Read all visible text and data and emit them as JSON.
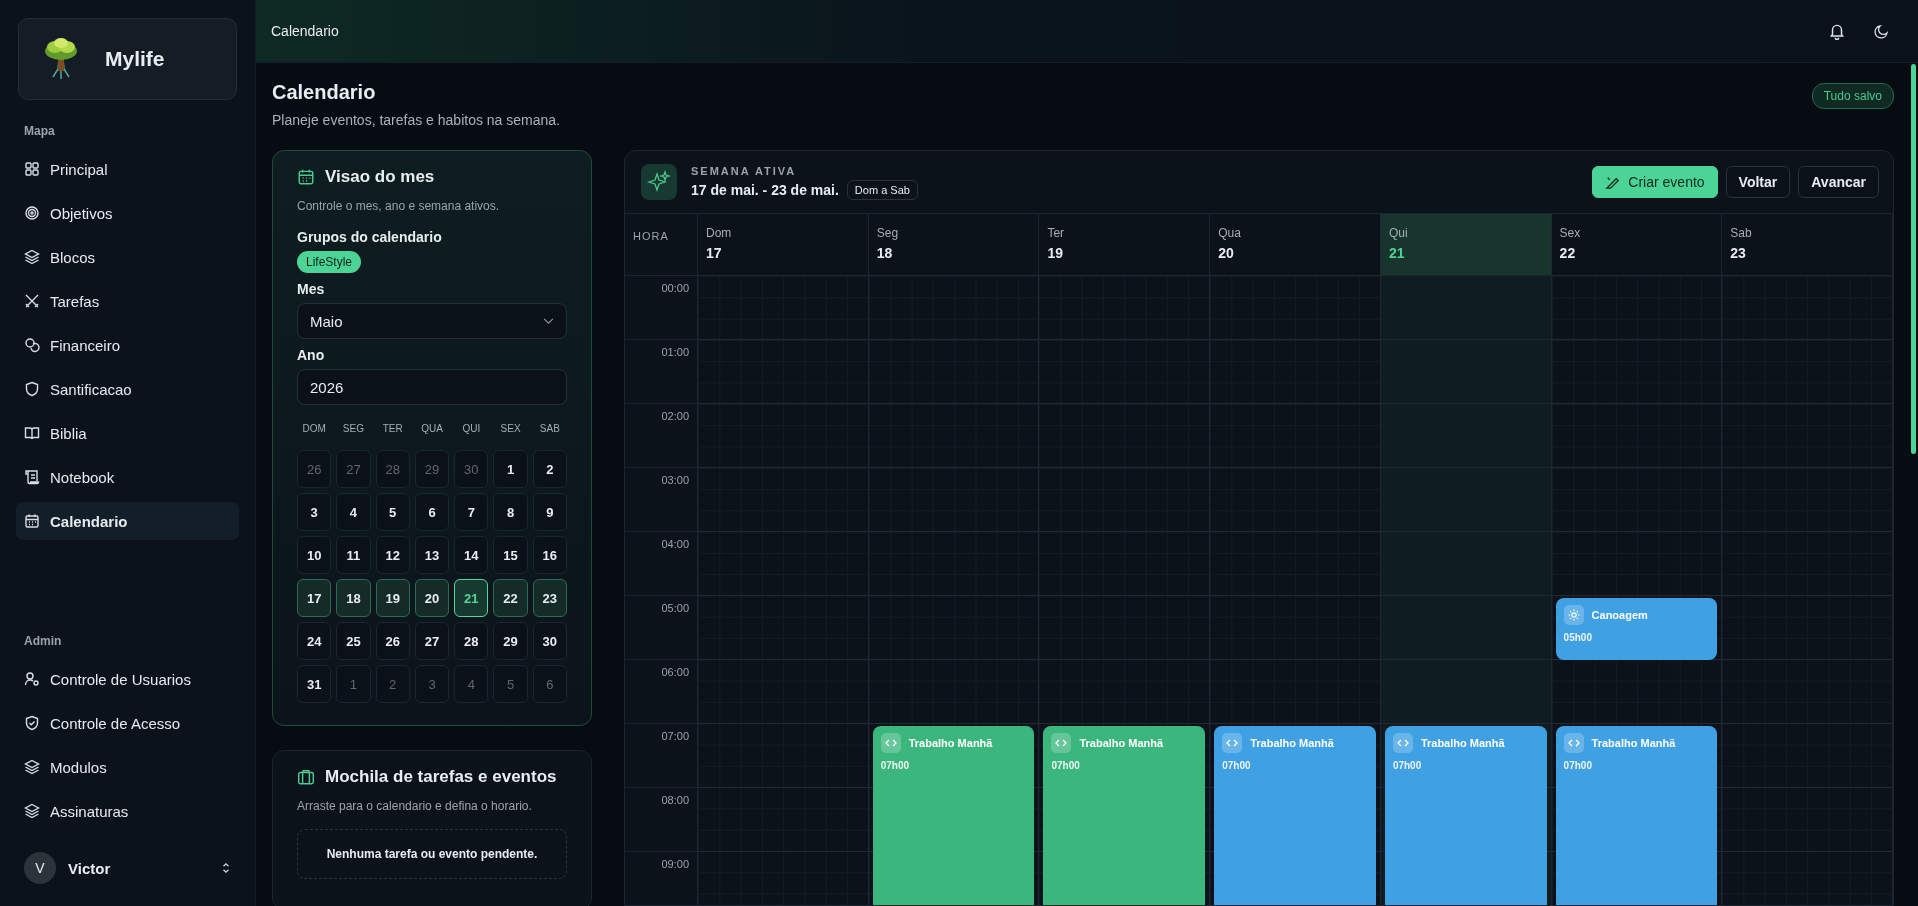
{
  "sidebar": {
    "brand": "Mylife",
    "sections": [
      {
        "title": "Mapa",
        "items": [
          {
            "label": "Principal",
            "selected": false
          },
          {
            "label": "Objetivos",
            "selected": false
          },
          {
            "label": "Blocos",
            "selected": false
          },
          {
            "label": "Tarefas",
            "selected": false
          },
          {
            "label": "Financeiro",
            "selected": false
          },
          {
            "label": "Santificacao",
            "selected": false
          },
          {
            "label": "Biblia",
            "selected": false
          },
          {
            "label": "Notebook",
            "selected": false
          },
          {
            "label": "Calendario",
            "selected": true
          }
        ]
      },
      {
        "title": "Admin",
        "items": [
          {
            "label": "Controle de Usuarios",
            "selected": false
          },
          {
            "label": "Controle de Acesso",
            "selected": false
          },
          {
            "label": "Modulos",
            "selected": false
          },
          {
            "label": "Assinaturas",
            "selected": false
          }
        ]
      }
    ],
    "user": {
      "initial": "V",
      "name": "Victor"
    }
  },
  "topbar": {
    "breadcrumb": "Calendario"
  },
  "page": {
    "title": "Calendario",
    "subtitle": "Planeje eventos, tarefas e habitos na semana.",
    "status": "Tudo salvo"
  },
  "month_panel": {
    "title": "Visao do mes",
    "subtitle": "Controle o mes, ano e semana ativos.",
    "groups_label": "Grupos do calendario",
    "groups": [
      "LifeStyle"
    ],
    "month_label": "Mes",
    "month": "Maio",
    "year_label": "Ano",
    "year": "2026",
    "weekdays": [
      "DOM",
      "SEG",
      "TER",
      "QUA",
      "QUI",
      "SEX",
      "SAB"
    ],
    "days": [
      {
        "label": "26",
        "muted": true,
        "in_week": false,
        "selected": false
      },
      {
        "label": "27",
        "muted": true,
        "in_week": false,
        "selected": false
      },
      {
        "label": "28",
        "muted": true,
        "in_week": false,
        "selected": false
      },
      {
        "label": "29",
        "muted": true,
        "in_week": false,
        "selected": false
      },
      {
        "label": "30",
        "muted": true,
        "in_week": false,
        "selected": false
      },
      {
        "label": "1",
        "muted": false,
        "in_week": false,
        "selected": false
      },
      {
        "label": "2",
        "muted": false,
        "in_week": false,
        "selected": false
      },
      {
        "label": "3",
        "muted": false,
        "in_week": false,
        "selected": false
      },
      {
        "label": "4",
        "muted": false,
        "in_week": false,
        "selected": false
      },
      {
        "label": "5",
        "muted": false,
        "in_week": false,
        "selected": false
      },
      {
        "label": "6",
        "muted": false,
        "in_week": false,
        "selected": false
      },
      {
        "label": "7",
        "muted": false,
        "in_week": false,
        "selected": false
      },
      {
        "label": "8",
        "muted": false,
        "in_week": false,
        "selected": false
      },
      {
        "label": "9",
        "muted": false,
        "in_week": false,
        "selected": false
      },
      {
        "label": "10",
        "muted": false,
        "in_week": false,
        "selected": false
      },
      {
        "label": "11",
        "muted": false,
        "in_week": false,
        "selected": false
      },
      {
        "label": "12",
        "muted": false,
        "in_week": false,
        "selected": false
      },
      {
        "label": "13",
        "muted": false,
        "in_week": false,
        "selected": false
      },
      {
        "label": "14",
        "muted": false,
        "in_week": false,
        "selected": false
      },
      {
        "label": "15",
        "muted": false,
        "in_week": false,
        "selected": false
      },
      {
        "label": "16",
        "muted": false,
        "in_week": false,
        "selected": false
      },
      {
        "label": "17",
        "muted": false,
        "in_week": true,
        "selected": false
      },
      {
        "label": "18",
        "muted": false,
        "in_week": true,
        "selected": false
      },
      {
        "label": "19",
        "muted": false,
        "in_week": true,
        "selected": false
      },
      {
        "label": "20",
        "muted": false,
        "in_week": true,
        "selected": false
      },
      {
        "label": "21",
        "muted": false,
        "in_week": true,
        "selected": true
      },
      {
        "label": "22",
        "muted": false,
        "in_week": true,
        "selected": false
      },
      {
        "label": "23",
        "muted": false,
        "in_week": true,
        "selected": false
      },
      {
        "label": "24",
        "muted": false,
        "in_week": false,
        "selected": false
      },
      {
        "label": "25",
        "muted": false,
        "in_week": false,
        "selected": false
      },
      {
        "label": "26",
        "muted": false,
        "in_week": false,
        "selected": false
      },
      {
        "label": "27",
        "muted": false,
        "in_week": false,
        "selected": false
      },
      {
        "label": "28",
        "muted": false,
        "in_week": false,
        "selected": false
      },
      {
        "label": "29",
        "muted": false,
        "in_week": false,
        "selected": false
      },
      {
        "label": "30",
        "muted": false,
        "in_week": false,
        "selected": false
      },
      {
        "label": "31",
        "muted": false,
        "in_week": false,
        "selected": false
      },
      {
        "label": "1",
        "muted": true,
        "in_week": false,
        "selected": false
      },
      {
        "label": "2",
        "muted": true,
        "in_week": false,
        "selected": false
      },
      {
        "label": "3",
        "muted": true,
        "in_week": false,
        "selected": false
      },
      {
        "label": "4",
        "muted": true,
        "in_week": false,
        "selected": false
      },
      {
        "label": "5",
        "muted": true,
        "in_week": false,
        "selected": false
      },
      {
        "label": "6",
        "muted": true,
        "in_week": false,
        "selected": false
      }
    ]
  },
  "backpack": {
    "title": "Mochila de tarefas e eventos",
    "subtitle": "Arraste para o calendario e defina o horario.",
    "empty": "Nenhuma tarefa ou evento pendente."
  },
  "week": {
    "label": "SEMANA ATIVA",
    "range": "17 de mai. - 23 de mai.",
    "badge": "Dom a Sab",
    "buttons": [
      {
        "label": "Criar evento",
        "kind": "primary"
      },
      {
        "label": "Voltar",
        "kind": "plain"
      },
      {
        "label": "Avancar",
        "kind": "plain"
      }
    ],
    "hour_heading": "HORA",
    "hours": [
      "00:00",
      "01:00",
      "02:00",
      "03:00",
      "04:00",
      "05:00",
      "06:00",
      "07:00",
      "08:00",
      "09:00"
    ],
    "days": [
      {
        "name": "Dom",
        "date": "17",
        "selected": false
      },
      {
        "name": "Seg",
        "date": "18",
        "selected": false,
        "events": [
          {
            "title": "Trabalho Manhã",
            "time": "07h00",
            "color": "#3bb77e",
            "kind": "code",
            "continues": true
          }
        ]
      },
      {
        "name": "Ter",
        "date": "19",
        "selected": false,
        "events": [
          {
            "title": "Trabalho Manhã",
            "time": "07h00",
            "color": "#3bb77e",
            "kind": "code",
            "continues": true
          }
        ]
      },
      {
        "name": "Qua",
        "date": "20",
        "selected": false,
        "events": [
          {
            "title": "Trabalho Manhã",
            "time": "07h00",
            "color": "#3fa0e3",
            "kind": "code",
            "continues": true
          }
        ]
      },
      {
        "name": "Qui",
        "date": "21",
        "selected": true,
        "events": [
          {
            "title": "Trabalho Manhã",
            "time": "07h00",
            "color": "#3fa0e3",
            "kind": "code",
            "continues": true
          }
        ]
      },
      {
        "name": "Sex",
        "date": "22",
        "selected": false,
        "events": [
          {
            "title": "Canoagem",
            "time": "05h00",
            "color": "#3fa0e3",
            "kind": "sun",
            "continues": false
          },
          {
            "title": "Trabalho Manhã",
            "time": "07h00",
            "color": "#3fa0e3",
            "kind": "code",
            "continues": true
          }
        ]
      },
      {
        "name": "Sab",
        "date": "23",
        "selected": false
      }
    ]
  }
}
